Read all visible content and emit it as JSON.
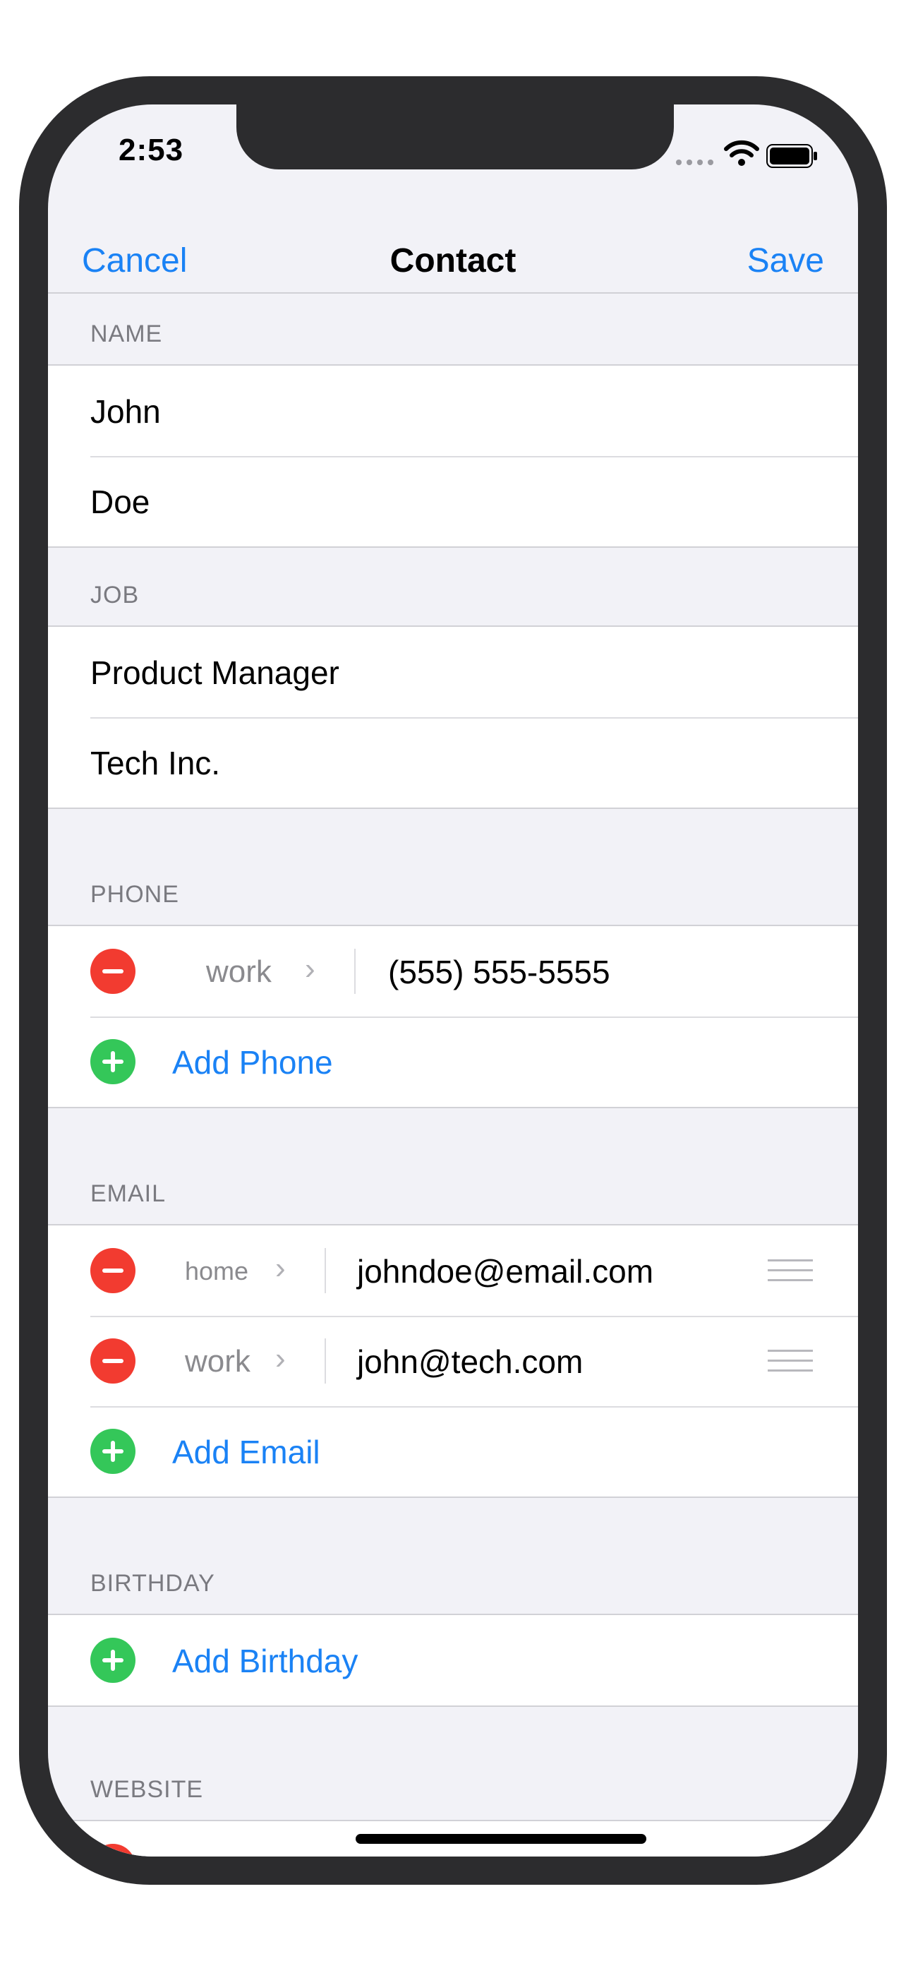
{
  "status_bar": {
    "time": "2:53"
  },
  "nav": {
    "cancel": "Cancel",
    "title": "Contact",
    "save": "Save"
  },
  "name": {
    "header": "NAME",
    "first": "John",
    "last": "Doe"
  },
  "job": {
    "header": "JOB",
    "title": "Product Manager",
    "company": "Tech Inc."
  },
  "phone": {
    "header": "PHONE",
    "entries": [
      {
        "label": "work",
        "value": "(555) 555-5555"
      }
    ],
    "add": "Add Phone"
  },
  "email": {
    "header": "EMAIL",
    "entries": [
      {
        "label": "home",
        "value": "johndoe@email.com"
      },
      {
        "label": "work",
        "value": "john@tech.com"
      }
    ],
    "add": "Add Email"
  },
  "birthday": {
    "header": "BIRTHDAY",
    "add": "Add Birthday"
  },
  "website": {
    "header": "WEBSITE"
  },
  "colors": {
    "accent": "#1a82f5",
    "delete": "#f23b30",
    "add": "#34c759"
  }
}
